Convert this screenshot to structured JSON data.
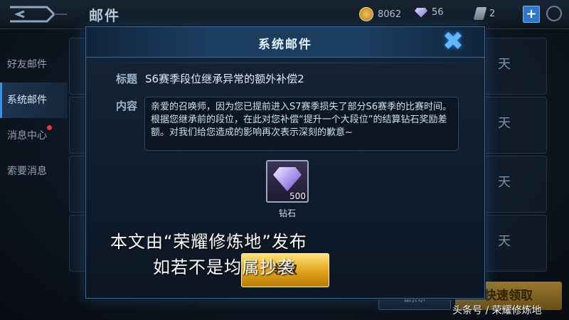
{
  "topbar": {
    "title": "邮件",
    "coins": "8062",
    "gems": "56",
    "tickets": "2",
    "plus_label": "+"
  },
  "sidebar": {
    "items": [
      {
        "label": "好友邮件",
        "active": false
      },
      {
        "label": "系统邮件",
        "active": true
      },
      {
        "label": "消息中心",
        "active": false,
        "badge": true
      },
      {
        "label": "索要消息",
        "active": false
      }
    ]
  },
  "background_list": {
    "days_label": "天",
    "delete_label": "删除",
    "quick_claim_label": "快速领取"
  },
  "modal": {
    "title": "系统邮件",
    "close_symbol": "✖",
    "subject_label": "标题",
    "subject": "S6赛季段位继承异常的额外补偿2",
    "content_label": "内容",
    "content": "亲爱的召唤师，因为您已提前进入S7赛季损失了部分S6赛季的比赛时间。根据您继承前的段位，在此对您补偿“提升一个大段位”的结算钻石奖励差额。对我们给您造成的影响再次表示深刻的歉意~",
    "reward": {
      "name": "钻石",
      "quantity": "500",
      "icon": "diamond-icon"
    },
    "claim_label": "领取"
  },
  "overlay": {
    "line1": "本文由“荣耀修炼地”发布",
    "line2": "如若不是均属抄袭",
    "watermark": "头条号 / 荣耀修炼地"
  }
}
